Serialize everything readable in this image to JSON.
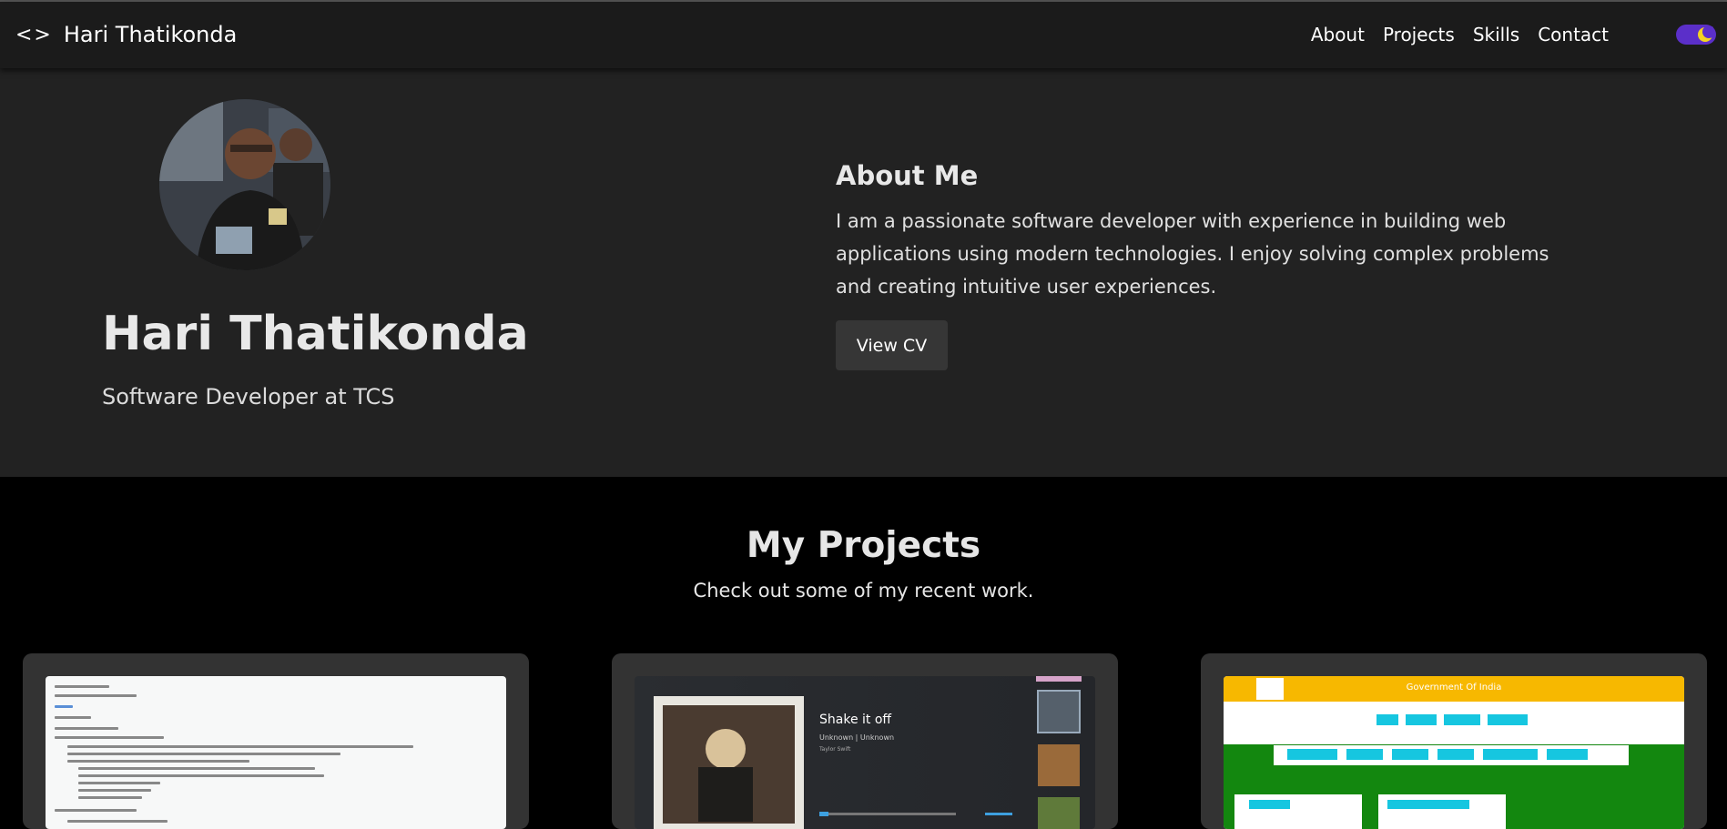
{
  "header": {
    "brand_icon": "code-icon",
    "brand_icon_text": "<>",
    "brand_name": "Hari Thatikonda",
    "nav": [
      "About",
      "Projects",
      "Skills",
      "Contact"
    ],
    "theme_toggle": {
      "state": "dark",
      "icon": "moon-icon",
      "color": "#5b2fc9"
    }
  },
  "hero": {
    "name": "Hari Thatikonda",
    "role": "Software Developer at TCS",
    "about_title": "About Me",
    "about_text": "I am a passionate software developer with experience in building web applications using modern technologies. I enjoy solving complex problems and creating intuitive user experiences.",
    "cv_button": "View CV"
  },
  "projects": {
    "title": "My Projects",
    "subtitle": "Check out some of my recent work.",
    "cards": [
      {
        "name": "project-card-chat"
      },
      {
        "name": "project-card-music",
        "song": "Shake it off",
        "meta": "Unknown | Unknown",
        "artist": "Taylor Swift"
      },
      {
        "name": "project-card-scholarship",
        "banner": "Government Of India"
      }
    ]
  }
}
